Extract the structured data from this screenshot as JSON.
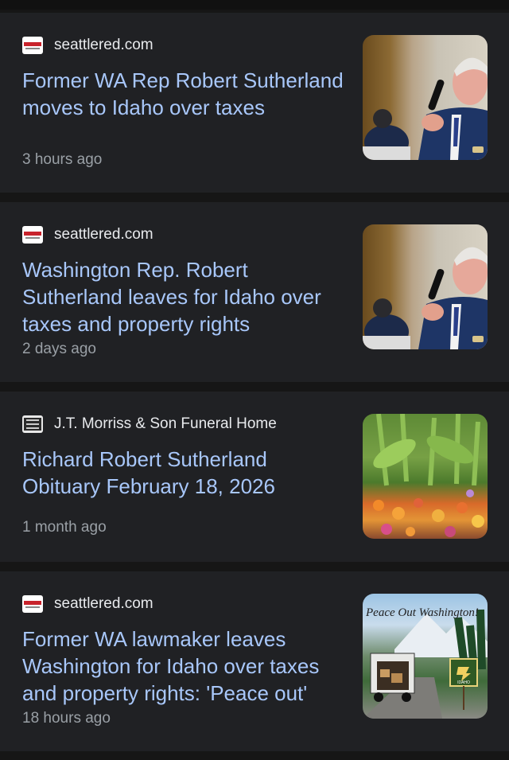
{
  "articles": [
    {
      "source": "seattlered.com",
      "title": "Former WA Rep Robert Sutherland moves to Idaho over taxes",
      "time": "3 hours ago",
      "thumbnail": "politician-speaking-photo"
    },
    {
      "source": "seattlered.com",
      "title": "Washington Rep. Robert Sutherland leaves for Idaho over taxes and property rights",
      "time": "2 days ago",
      "thumbnail": "politician-speaking-photo"
    },
    {
      "source": "J.T. Morriss & Son Funeral Home",
      "title": "Richard Robert Sutherland Obituary February 18, 2026",
      "time": "1 month ago",
      "thumbnail": "wildflowers-photo"
    },
    {
      "source": "seattlered.com",
      "title": "Former WA lawmaker leaves Washington for Idaho over taxes and property rights: 'Peace out'",
      "time": "18 hours ago",
      "thumbnail": "moving-truck-illustration",
      "thumbnail_text": "Peace Out Washington!",
      "sign_text": "IDAHO"
    }
  ],
  "colors": {
    "card": "#202124",
    "gap": "#161616",
    "title": "#a8c7fa",
    "source": "#e8eaed",
    "time": "#9aa0a6"
  }
}
